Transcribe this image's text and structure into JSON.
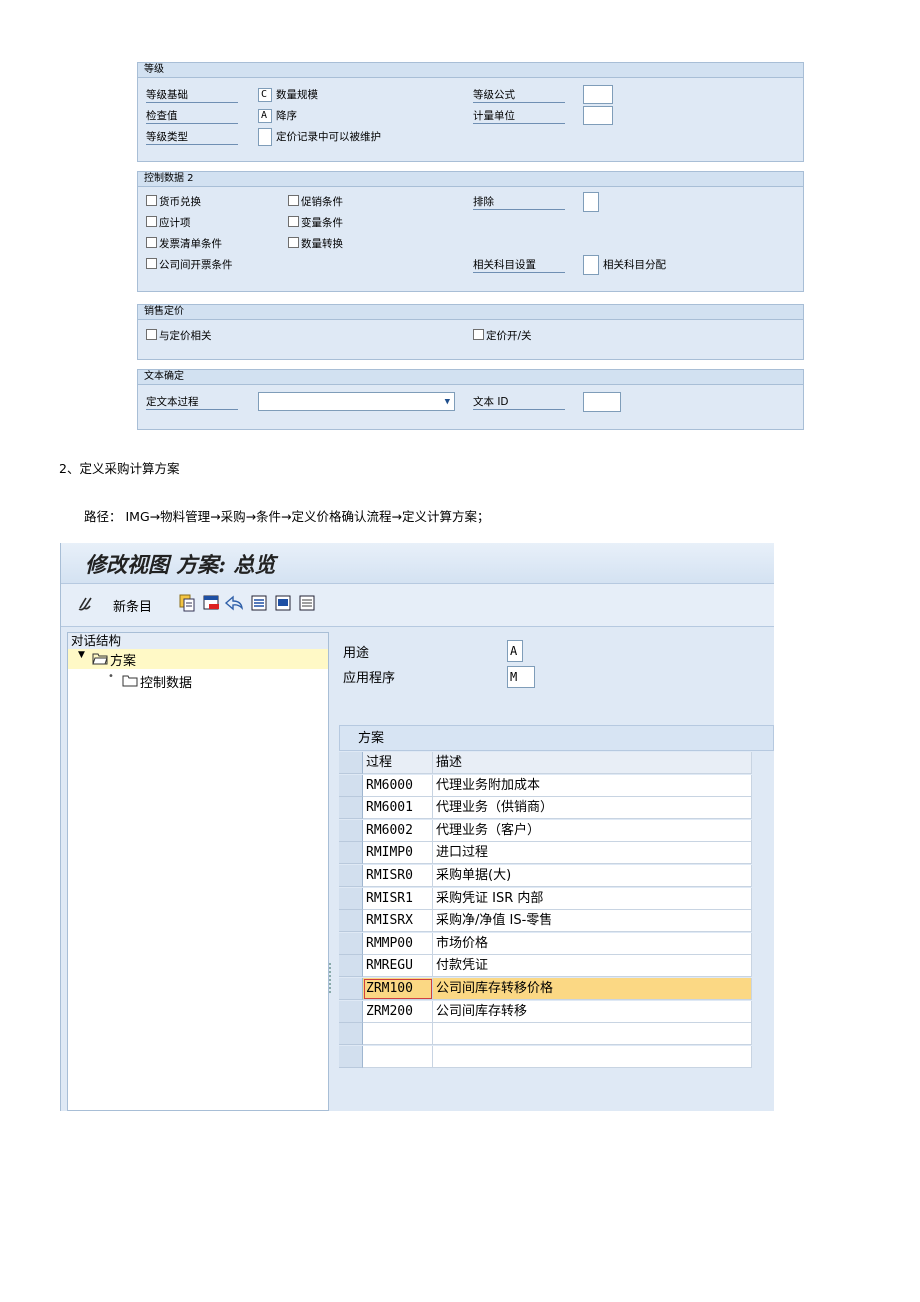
{
  "panel1": {
    "group_grade": {
      "header": "等级",
      "basis_label": "等级基础",
      "basis_value": "C",
      "basis_text": "数量规模",
      "formula_label": "等级公式",
      "check_label": "检查值",
      "check_value": "A",
      "check_text": "降序",
      "unit_label": "计量单位",
      "type_label": "等级类型",
      "type_text": "定价记录中可以被维护"
    },
    "group_control2": {
      "header": "控制数据 2",
      "currency": "货币兑换",
      "promo": "促销条件",
      "exclude_label": "排除",
      "accrual": "应计项",
      "variant": "变量条件",
      "invoice_list": "发票清单条件",
      "qty_conv": "数量转换",
      "interco": "公司间开票条件",
      "acct_settings_label": "相关科目设置",
      "acct_assign": "相关科目分配"
    },
    "group_sales": {
      "header": "销售定价",
      "pricing_related": "与定价相关",
      "pricing_onoff": "定价开/关"
    },
    "group_text": {
      "header": "文本确定",
      "text_proc_label": "定文本过程",
      "text_id_label": "文本 ID"
    }
  },
  "section_heading": "2、定义采购计算方案",
  "path_text": "路径： IMG→物料管理→采购→条件→定义价格确认流程→定义计算方案；",
  "window": {
    "title": "修改视图 方案: 总览",
    "new_entries": "新条目",
    "nav": {
      "header": "对话结构",
      "item_scheme": "方案",
      "item_control": "控制数据"
    },
    "usage_label": "用途",
    "usage_value": "A",
    "application_label": "应用程序",
    "application_value": "M",
    "table": {
      "title": "方案",
      "col_proc": "过程",
      "col_desc": "描述",
      "rows": [
        {
          "proc": "RM6000",
          "desc": "代理业务附加成本"
        },
        {
          "proc": "RM6001",
          "desc": "代理业务（供销商）"
        },
        {
          "proc": "RM6002",
          "desc": "代理业务（客户）"
        },
        {
          "proc": "RMIMP0",
          "desc": "进口过程"
        },
        {
          "proc": "RMISR0",
          "desc": "采购单据(大)"
        },
        {
          "proc": "RMISR1",
          "desc": "采购凭证 ISR 内部"
        },
        {
          "proc": "RMISRX",
          "desc": "采购净/净值 IS-零售"
        },
        {
          "proc": "RMMP00",
          "desc": "市场价格"
        },
        {
          "proc": "RMREGU",
          "desc": "付款凭证"
        },
        {
          "proc": "ZRM100",
          "desc": "公司间库存转移价格"
        },
        {
          "proc": "ZRM200",
          "desc": "公司间库存转移"
        }
      ],
      "selected_index": 9
    }
  },
  "colors": {
    "panel_bg": "#dfe9f5",
    "selected_row": "#fbd884",
    "tree_highlight": "#fff9c6"
  }
}
